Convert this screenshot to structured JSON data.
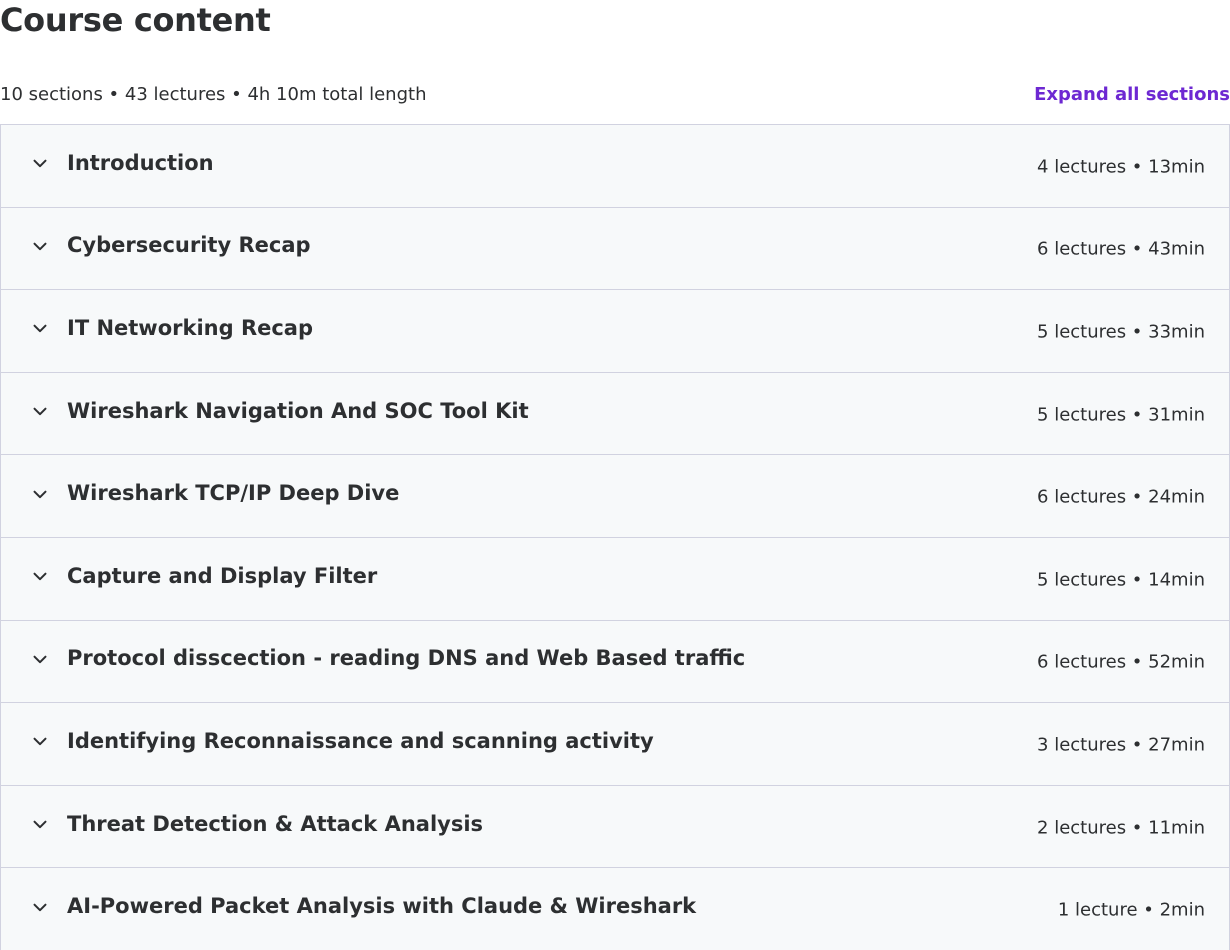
{
  "header": {
    "title": "Course content",
    "summary": "10 sections • 43 lectures • 4h 10m total length",
    "expand_all_label": "Expand all sections"
  },
  "sections": [
    {
      "title": "Introduction",
      "meta": "4 lectures • 13min"
    },
    {
      "title": "Cybersecurity Recap",
      "meta": "6 lectures • 43min"
    },
    {
      "title": "IT Networking Recap",
      "meta": "5 lectures • 33min"
    },
    {
      "title": "Wireshark Navigation And SOC Tool Kit",
      "meta": "5 lectures • 31min"
    },
    {
      "title": "Wireshark TCP/IP Deep Dive",
      "meta": "6 lectures • 24min"
    },
    {
      "title": "Capture and Display Filter",
      "meta": "5 lectures • 14min"
    },
    {
      "title": "Protocol disscection - reading DNS and Web Based traffic",
      "meta": "6 lectures • 52min"
    },
    {
      "title": "Identifying Reconnaissance and scanning activity",
      "meta": "3 lectures • 27min"
    },
    {
      "title": "Threat Detection & Attack Analysis",
      "meta": "2 lectures • 11min"
    },
    {
      "title": "AI-Powered Packet Analysis with Claude & Wireshark",
      "meta": "1 lecture • 2min"
    }
  ],
  "icons": {
    "section_toggle": "chevron-down-icon"
  },
  "colors": {
    "accent": "#6d28d2",
    "text": "#2d2f31",
    "section_bg": "#f7f9fa",
    "border": "#d1d2e0"
  }
}
